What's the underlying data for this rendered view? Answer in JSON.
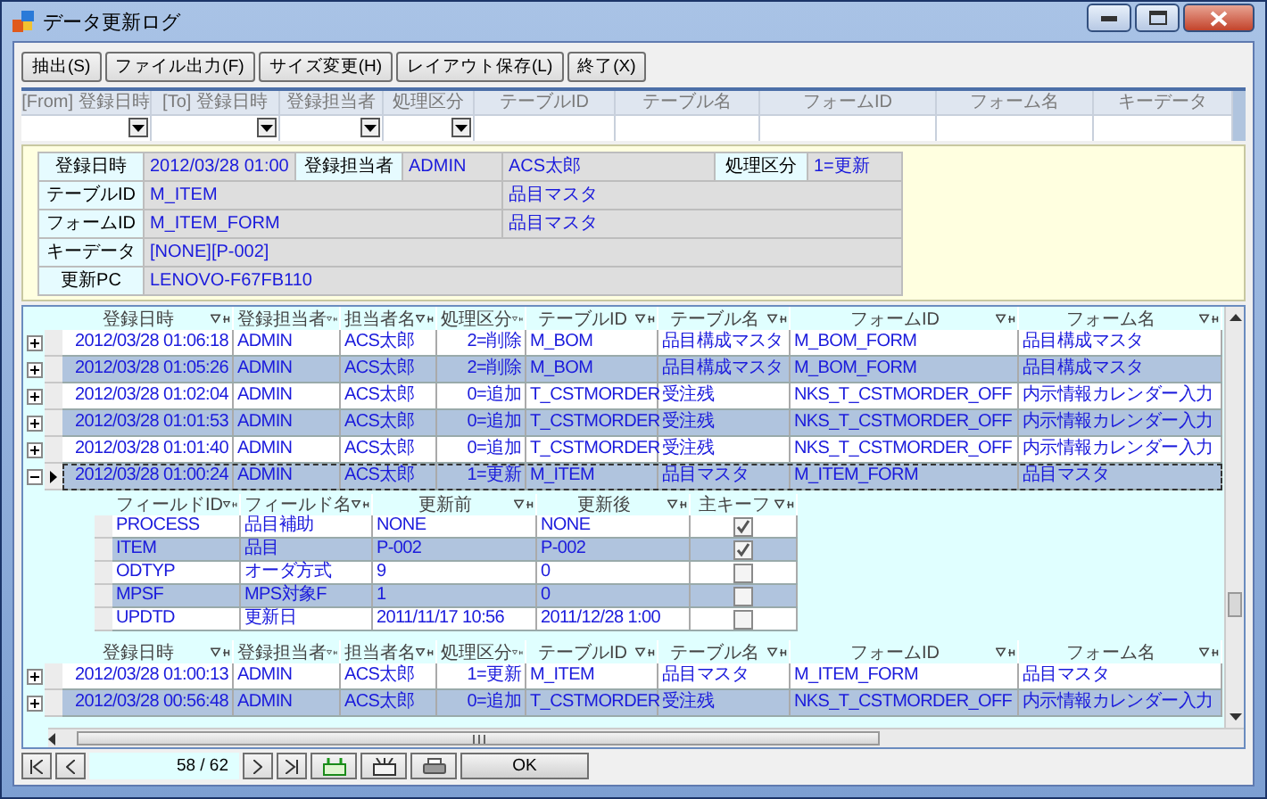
{
  "window": {
    "title": "データ更新ログ"
  },
  "toolbar": [
    "抽出(S)",
    "ファイル出力(F)",
    "サイズ変更(H)",
    "レイアウト保存(L)",
    "終了(X)"
  ],
  "filter": {
    "columns": [
      {
        "label": "[From] 登録日時",
        "kind": "dropdown"
      },
      {
        "label": "[To] 登録日時",
        "kind": "dropdown"
      },
      {
        "label": "登録担当者",
        "kind": "dropdown"
      },
      {
        "label": "処理区分",
        "kind": "dropdown"
      },
      {
        "label": "テーブルID",
        "kind": "text"
      },
      {
        "label": "テーブル名",
        "kind": "text"
      },
      {
        "label": "フォームID",
        "kind": "text"
      },
      {
        "label": "フォーム名",
        "kind": "text"
      },
      {
        "label": "キーデータ",
        "kind": "text"
      }
    ]
  },
  "detail": {
    "rows": [
      {
        "cells": [
          {
            "kind": "label",
            "text": "登録日時"
          },
          {
            "kind": "value",
            "text": "2012/03/28 01:00"
          },
          {
            "kind": "label",
            "text": "登録担当者"
          },
          {
            "kind": "value",
            "text": "ADMIN"
          },
          {
            "kind": "value",
            "text": "ACS太郎"
          },
          {
            "kind": "label",
            "text": "処理区分"
          },
          {
            "kind": "value",
            "text": "1=更新"
          }
        ]
      },
      {
        "cells": [
          {
            "kind": "label",
            "text": "テーブルID"
          },
          {
            "kind": "value",
            "text": "M_ITEM"
          },
          {
            "kind": "value",
            "text": "品目マスタ"
          }
        ]
      },
      {
        "cells": [
          {
            "kind": "label",
            "text": "フォームID"
          },
          {
            "kind": "value",
            "text": "M_ITEM_FORM"
          },
          {
            "kind": "value",
            "text": "品目マスタ"
          }
        ]
      },
      {
        "cells": [
          {
            "kind": "label",
            "text": "キーデータ"
          },
          {
            "kind": "value",
            "text": "[NONE][P-002]"
          }
        ]
      },
      {
        "cells": [
          {
            "kind": "label",
            "text": "更新PC"
          },
          {
            "kind": "value",
            "text": "LENOVO-F67FB110"
          }
        ]
      }
    ]
  },
  "grid": {
    "columns": [
      "登録日時",
      "登録担当者",
      "担当者名",
      "処理区分",
      "テーブルID",
      "テーブル名",
      "フォームID",
      "フォーム名"
    ],
    "rows": [
      {
        "cells": [
          "2012/03/28 01:06:18",
          "ADMIN",
          "ACS太郎",
          "2=削除",
          "M_BOM",
          "品目構成マスタ",
          "M_BOM_FORM",
          "品目構成マスタ"
        ],
        "expanded": false,
        "current": false
      },
      {
        "cells": [
          "2012/03/28 01:05:26",
          "ADMIN",
          "ACS太郎",
          "2=削除",
          "M_BOM",
          "品目構成マスタ",
          "M_BOM_FORM",
          "品目構成マスタ"
        ],
        "expanded": false,
        "current": false
      },
      {
        "cells": [
          "2012/03/28 01:02:04",
          "ADMIN",
          "ACS太郎",
          "0=追加",
          "T_CSTMORDER",
          "受注残",
          "NKS_T_CSTMORDER_OFF",
          "内示情報カレンダー入力"
        ],
        "expanded": false,
        "current": false
      },
      {
        "cells": [
          "2012/03/28 01:01:53",
          "ADMIN",
          "ACS太郎",
          "0=追加",
          "T_CSTMORDER",
          "受注残",
          "NKS_T_CSTMORDER_OFF",
          "内示情報カレンダー入力"
        ],
        "expanded": false,
        "current": false
      },
      {
        "cells": [
          "2012/03/28 01:01:40",
          "ADMIN",
          "ACS太郎",
          "0=追加",
          "T_CSTMORDER",
          "受注残",
          "NKS_T_CSTMORDER_OFF",
          "内示情報カレンダー入力"
        ],
        "expanded": false,
        "current": false
      },
      {
        "cells": [
          "2012/03/28 01:00:24",
          "ADMIN",
          "ACS太郎",
          "1=更新",
          "M_ITEM",
          "品目マスタ",
          "M_ITEM_FORM",
          "品目マスタ"
        ],
        "expanded": true,
        "current": true,
        "children": {
          "columns": [
            "フィールドID",
            "フィールド名",
            "更新前",
            "更新後",
            "主キーフ"
          ],
          "rows": [
            {
              "cells": [
                "PROCESS",
                "品目補助",
                "NONE",
                "NONE"
              ],
              "checked": true
            },
            {
              "cells": [
                "ITEM",
                "品目",
                "P-002",
                "P-002"
              ],
              "checked": true
            },
            {
              "cells": [
                "ODTYP",
                "オーダ方式",
                "9",
                "0"
              ],
              "checked": false
            },
            {
              "cells": [
                "MPSF",
                "MPS対象F",
                "1",
                "0"
              ],
              "checked": false
            },
            {
              "cells": [
                "UPDTD",
                "更新日",
                "2011/11/17 10:56",
                "2011/12/28 1:00"
              ],
              "checked": false
            }
          ]
        }
      }
    ],
    "lower_columns": [
      "登録日時",
      "登録担当者",
      "担当者名",
      "処理区分",
      "テーブルID",
      "テーブル名",
      "フォームID",
      "フォーム名"
    ],
    "lower_rows": [
      {
        "cells": [
          "2012/03/28 01:00:13",
          "ADMIN",
          "ACS太郎",
          "1=更新",
          "M_ITEM",
          "品目マスタ",
          "M_ITEM_FORM",
          "品目マスタ"
        ],
        "expanded": false,
        "current": false
      },
      {
        "cells": [
          "2012/03/28 00:56:48",
          "ADMIN",
          "ACS太郎",
          "0=追加",
          "T_CSTMORDER",
          "受注残",
          "NKS_T_CSTMORDER_OFF",
          "内示情報カレンダー入力"
        ],
        "expanded": false,
        "current": false
      }
    ]
  },
  "pager": {
    "position": "58 / 62",
    "ok": "OK"
  }
}
